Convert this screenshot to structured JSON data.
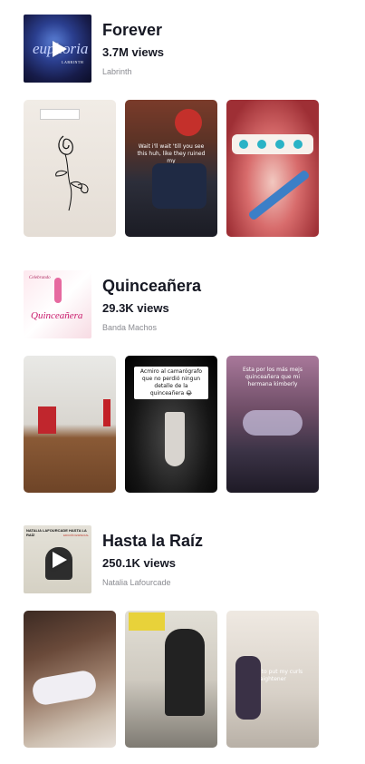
{
  "sounds": [
    {
      "title": "Forever",
      "views": "3.7M views",
      "artist": "Labrinth",
      "cover_text": "euphoria",
      "cover_subtext": "LABRINTH",
      "videos": [
        {
          "caption": ""
        },
        {
          "caption": "Wait i'll wait 'till you see this huh, like they ruined my"
        },
        {
          "caption": ""
        }
      ]
    },
    {
      "title": "Quinceañera",
      "views": "29.3K views",
      "artist": "Banda Machos",
      "cover_text": "Quinceañera",
      "cover_subtext": "Celebrando",
      "videos": [
        {
          "caption": ""
        },
        {
          "caption": "Acmiro al camarógrafo que no perdió ningun detalle de la quinceañera 😂"
        },
        {
          "caption": "Esta por los más mejs quinceañera que mi hermana kimberly"
        }
      ]
    },
    {
      "title": "Hasta la Raíz",
      "views": "250.1K views",
      "artist": "Natalia Lafourcade",
      "cover_text": "NATALIA LAFOURCADE   HASTA LA RAÍZ",
      "cover_subtext": "EDICIÓN ESPECIAL",
      "videos": [
        {
          "caption": ""
        },
        {
          "caption": ""
        },
        {
          "caption": "me: tries to put my curls into a straightener"
        }
      ]
    }
  ]
}
